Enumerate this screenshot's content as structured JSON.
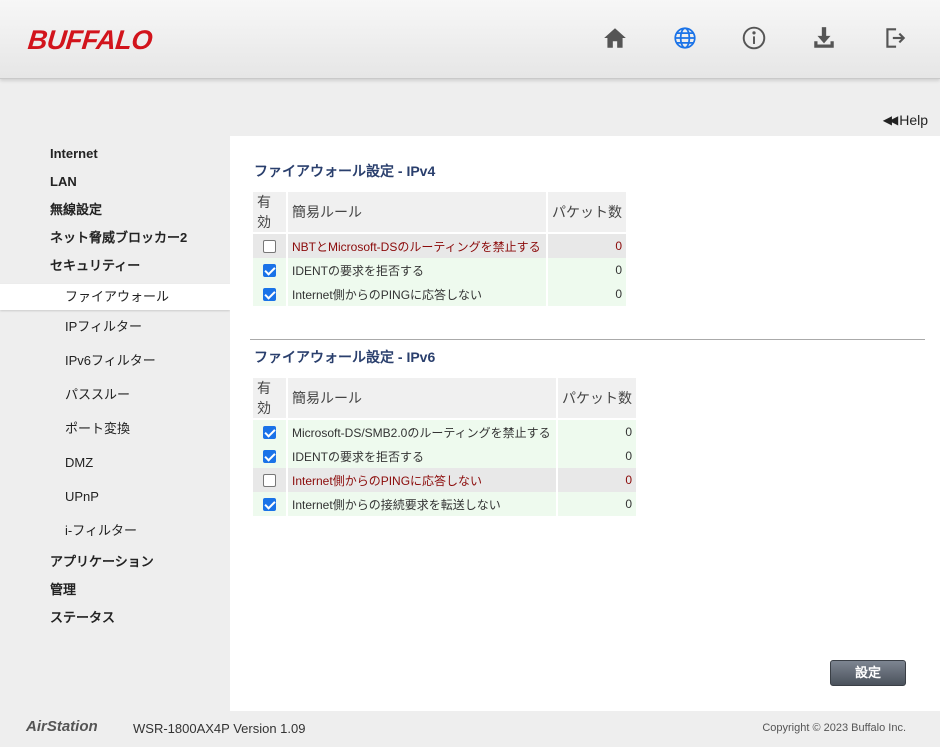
{
  "header": {
    "brand": "BUFFALO",
    "icons": [
      "home-icon",
      "globe-icon",
      "info-icon",
      "download-icon",
      "logout-icon"
    ],
    "brand_color": "#d2141c",
    "active_icon_color": "#1a73e8"
  },
  "help": {
    "label": "Help"
  },
  "sidebar": {
    "items_top": [
      "Internet",
      "LAN",
      "無線設定",
      "ネット脅威ブロッカー2",
      "セキュリティー"
    ],
    "subitems": [
      "ファイアウォール",
      "IPフィルター",
      "IPv6フィルター",
      "パススルー",
      "ポート変換",
      "DMZ",
      "UPnP",
      "i-フィルター"
    ],
    "items_bottom": [
      "アプリケーション",
      "管理",
      "ステータス"
    ],
    "active": "ファイアウォール"
  },
  "ipv4": {
    "title": "ファイアウォール設定 - IPv4",
    "headers": {
      "enabled": "有効",
      "rule": "簡易ルール",
      "packets": "パケット数"
    },
    "rows": [
      {
        "enabled": false,
        "rule": "NBTとMicrosoft-DSのルーティングを禁止する",
        "packets": "0"
      },
      {
        "enabled": true,
        "rule": "IDENTの要求を拒否する",
        "packets": "0"
      },
      {
        "enabled": true,
        "rule": "Internet側からのPINGに応答しない",
        "packets": "0"
      }
    ]
  },
  "ipv6": {
    "title": "ファイアウォール設定 - IPv6",
    "headers": {
      "enabled": "有効",
      "rule": "簡易ルール",
      "packets": "パケット数"
    },
    "rows": [
      {
        "enabled": true,
        "rule": "Microsoft-DS/SMB2.0のルーティングを禁止する",
        "packets": "0"
      },
      {
        "enabled": true,
        "rule": "IDENTの要求を拒否する",
        "packets": "0"
      },
      {
        "enabled": false,
        "rule": "Internet側からのPINGに応答しない",
        "packets": "0"
      },
      {
        "enabled": true,
        "rule": "Internet側からの接続要求を転送しない",
        "packets": "0"
      }
    ]
  },
  "buttons": {
    "save": "設定"
  },
  "footer": {
    "product": "AirStation",
    "version": "WSR-1800AX4P Version 1.09",
    "copyright": "Copyright © 2023 Buffalo Inc."
  }
}
